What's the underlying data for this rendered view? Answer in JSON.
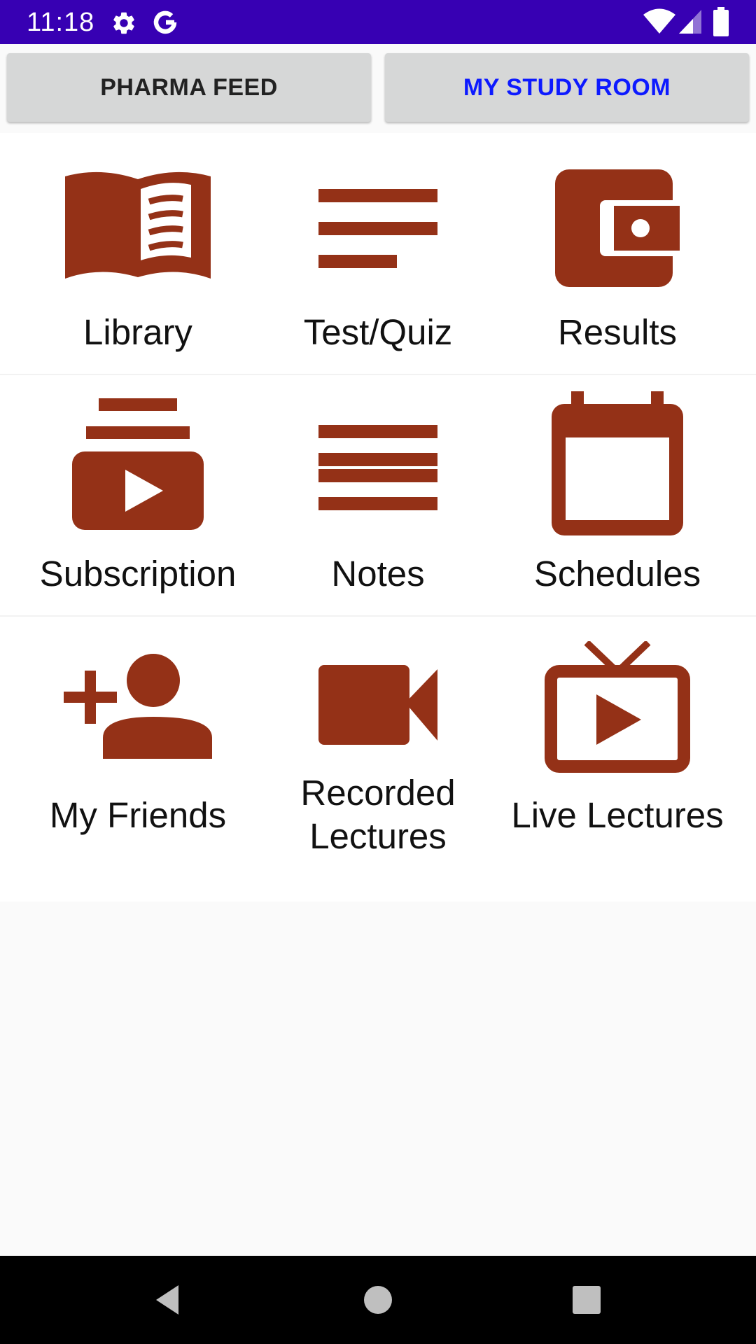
{
  "status_bar": {
    "time": "11:18",
    "icons": [
      "settings-icon",
      "google-icon",
      "wifi-icon",
      "cellular-signal-icon",
      "battery-icon"
    ],
    "background_color": "#3700b3"
  },
  "tabs": {
    "pharma_feed": "PHARMA FEED",
    "my_study_room": "MY STUDY ROOM",
    "active_color": "#0d1aff"
  },
  "accent_color": "#943117",
  "tiles": [
    {
      "label": "Library",
      "icon": "open-book-icon"
    },
    {
      "label": "Test/Quiz",
      "icon": "short-text-icon"
    },
    {
      "label": "Results",
      "icon": "wallet-icon"
    },
    {
      "label": "Subscription",
      "icon": "subscriptions-icon"
    },
    {
      "label": "Notes",
      "icon": "notes-icon"
    },
    {
      "label": "Schedules",
      "icon": "calendar-icon"
    },
    {
      "label": "My Friends",
      "icon": "person-add-icon"
    },
    {
      "label": "Recorded\nLectures",
      "icon": "videocam-icon"
    },
    {
      "label": "Live Lectures",
      "icon": "live-tv-icon"
    }
  ],
  "nav_bar": {
    "icons": [
      "back-icon",
      "home-icon",
      "recents-icon"
    ]
  }
}
